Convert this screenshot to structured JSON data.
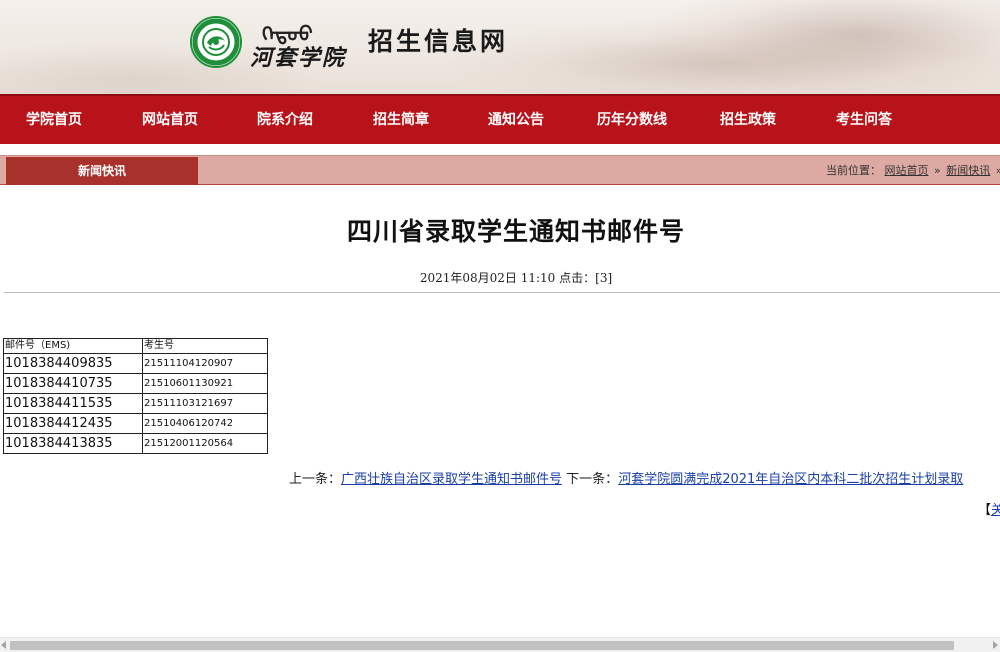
{
  "header": {
    "mongolian_script": "ᠬᠡᠲᠣᠣ",
    "school_name": "河套学院",
    "site_name": "招生信息网",
    "logo_icon": "college-emblem-icon",
    "logo_color": "#1f8f3a"
  },
  "nav": {
    "background": "#b8131a",
    "items": [
      {
        "label": "学院首页"
      },
      {
        "label": "网站首页"
      },
      {
        "label": "院系介绍"
      },
      {
        "label": "招生简章"
      },
      {
        "label": "通知公告"
      },
      {
        "label": "历年分数线"
      },
      {
        "label": "招生政策"
      },
      {
        "label": "考生问答"
      }
    ]
  },
  "subbar": {
    "tab_label": "新闻快讯",
    "breadcrumb_prefix": "当前位置：",
    "crumbs": [
      "网站首页",
      "新闻快讯"
    ],
    "separator": "»"
  },
  "article": {
    "title": "四川省录取学生通知书邮件号",
    "meta": "2021年08月02日 11:10  点击：[3]",
    "table": {
      "headers": [
        "邮件号（EMS)",
        "考生号"
      ],
      "rows": [
        [
          "1018384409835",
          "21511104120907"
        ],
        [
          "1018384410735",
          "21510601130921"
        ],
        [
          "1018384411535",
          "21511103121697"
        ],
        [
          "1018384412435",
          "21510406120742"
        ],
        [
          "1018384413835",
          "21512001120564"
        ]
      ]
    },
    "prev_label": "上一条：",
    "prev_link": "广西壮族自治区录取学生通知书邮件号",
    "next_label": "下一条：",
    "next_link": "河套学院圆满完成2021年自治区内本科二批次招生计划录取",
    "close_bracket": "【",
    "close_link": "关"
  },
  "colors": {
    "nav_red": "#b8131a",
    "subbar_pink": "#dcaaa2",
    "tab_dark_red": "#a9312b",
    "link_blue": "#1a3fa8"
  }
}
